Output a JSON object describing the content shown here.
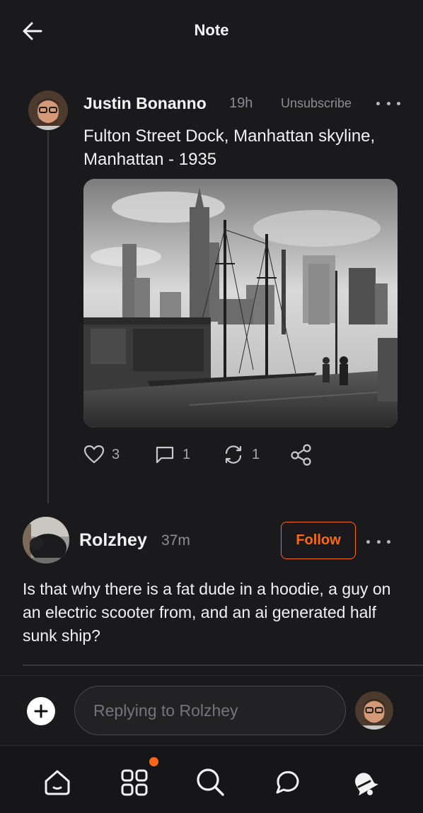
{
  "header": {
    "title": "Note",
    "back_icon": "arrow-left-icon"
  },
  "post": {
    "author": "Justin Bonanno",
    "time": "19h",
    "unsubscribe_label": "Unsubscribe",
    "body": "Fulton Street Dock, Manhattan skyline, Manhattan - 1935",
    "actions": {
      "likes": "3",
      "comments": "1",
      "restacks": "1"
    }
  },
  "reply": {
    "author": "Rolzhey",
    "time": "37m",
    "follow_label": "Follow",
    "body": "Is that why there is a fat dude in a hoodie, a guy on an electric scooter from, and an ai generated half sunk ship?"
  },
  "composer": {
    "placeholder": "Replying to Rolzhey"
  },
  "tabs": [
    "home-icon",
    "grid-icon",
    "search-icon",
    "chat-icon",
    "bell-icon"
  ],
  "colors": {
    "accent": "#ff6719",
    "background": "#1a191b",
    "muted": "#8e8d92"
  }
}
